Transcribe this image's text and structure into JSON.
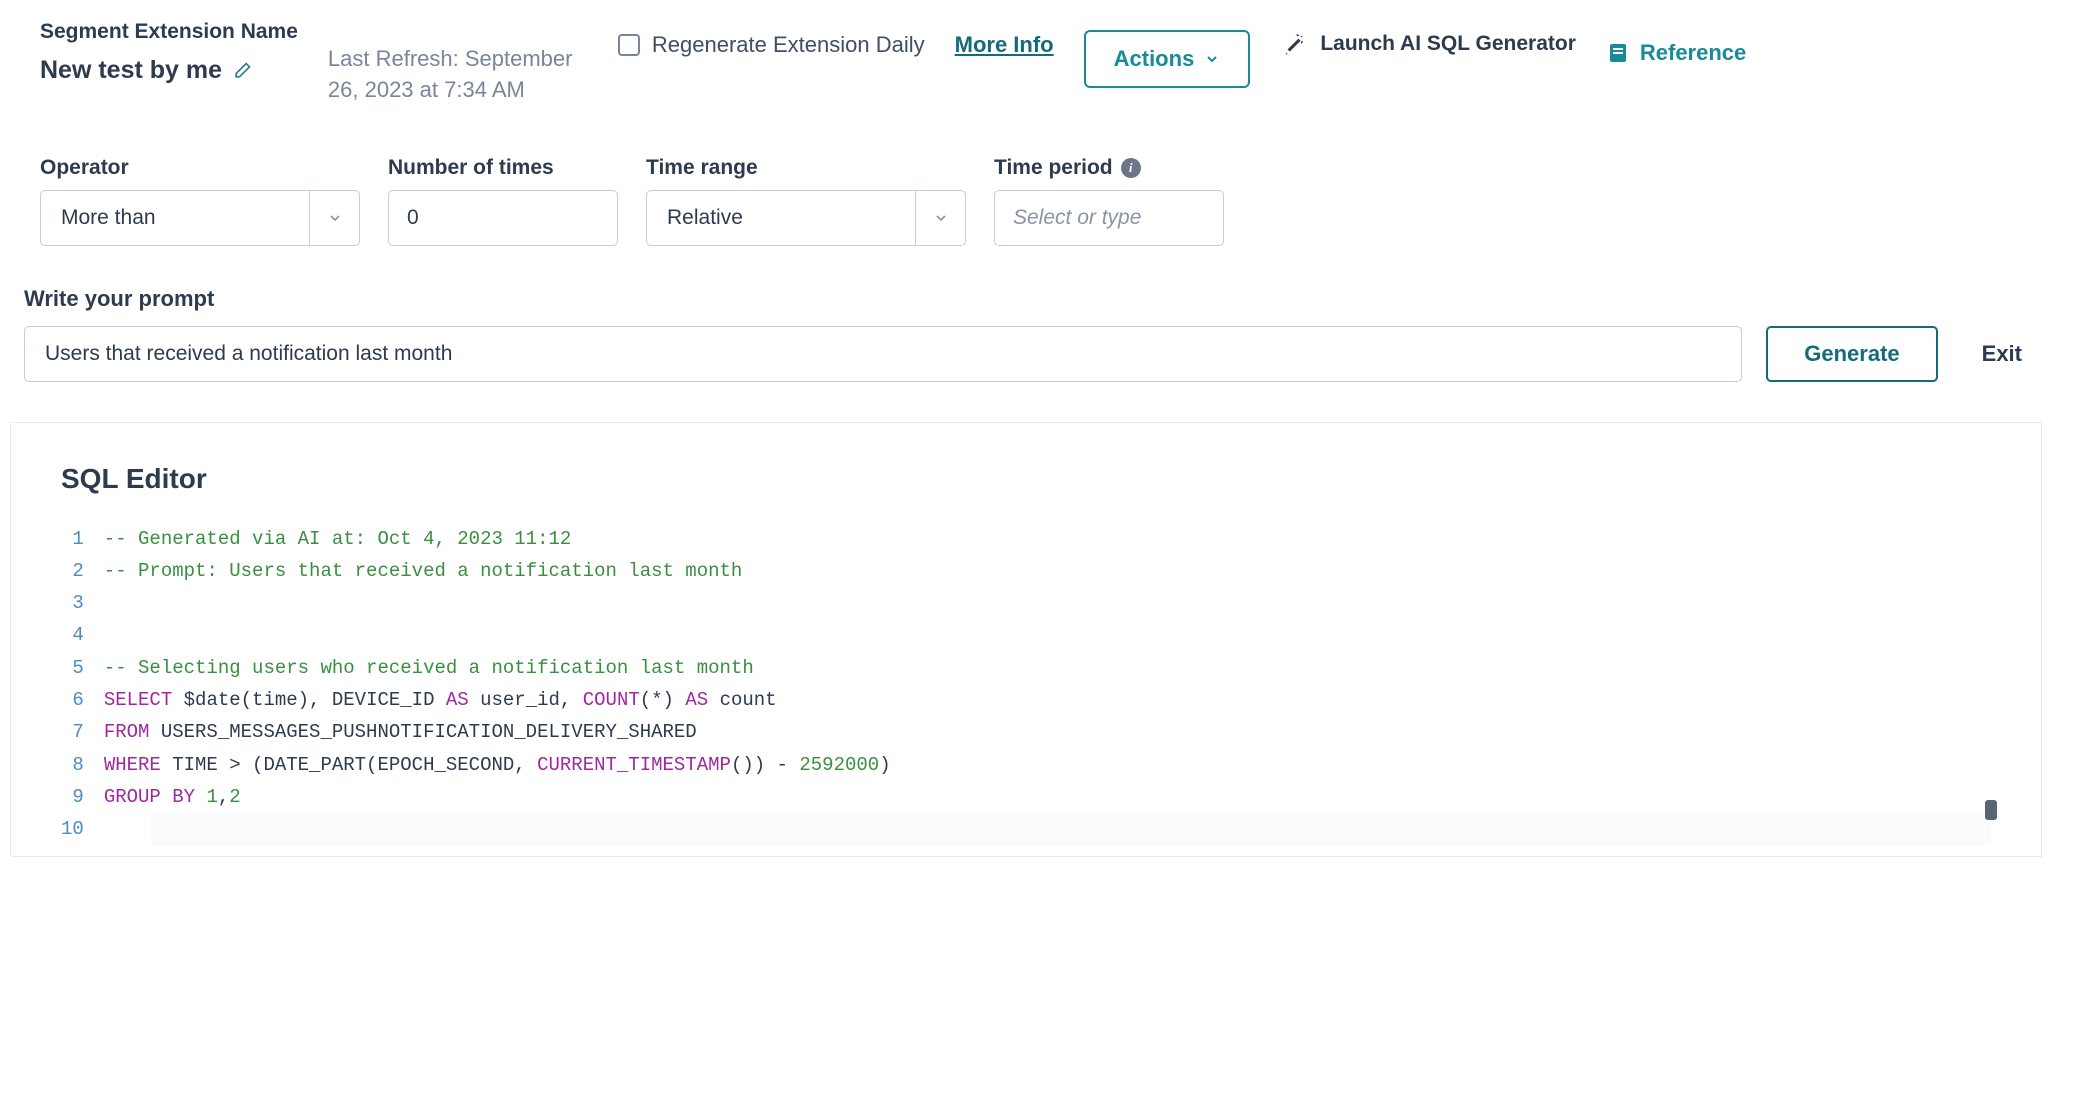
{
  "header": {
    "segment_name_label": "Segment Extension Name",
    "segment_name": "New test by me",
    "last_refresh": "Last Refresh: September 26, 2023 at 7:34 AM",
    "regenerate_label": "Regenerate Extension Daily",
    "more_info": "More Info",
    "actions_label": "Actions",
    "launch_label": "Launch AI SQL Generator",
    "reference_label": "Reference"
  },
  "filters": {
    "operator": {
      "label": "Operator",
      "value": "More than"
    },
    "num_times": {
      "label": "Number of times",
      "value": "0"
    },
    "time_range": {
      "label": "Time range",
      "value": "Relative"
    },
    "time_period": {
      "label": "Time period",
      "placeholder": "Select or type"
    }
  },
  "prompt": {
    "label": "Write your prompt",
    "value": "Users that received a notification last month",
    "generate": "Generate",
    "exit": "Exit"
  },
  "sql": {
    "title": "SQL Editor",
    "lines": [
      "-- Generated via AI at: Oct 4, 2023 11:12",
      "-- Prompt: Users that received a notification last month",
      "",
      "",
      "-- Selecting users who received a notification last month",
      "SELECT $date(time), DEVICE_ID AS user_id, COUNT(*) AS count",
      "FROM USERS_MESSAGES_PUSHNOTIFICATION_DELIVERY_SHARED",
      "WHERE TIME > (DATE_PART(EPOCH_SECOND, CURRENT_TIMESTAMP()) - 2592000)",
      "GROUP BY 1,2",
      ""
    ]
  }
}
